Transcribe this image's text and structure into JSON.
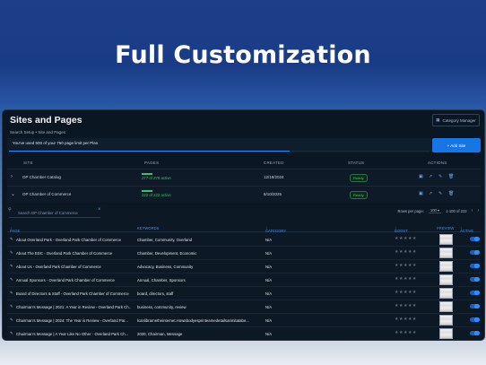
{
  "hero": {
    "title": "Full Customization"
  },
  "app": {
    "title": "Sites and Pages",
    "breadcrumb": "Search Setup • Site and Pages",
    "category_manager": "Category Manager",
    "usage_text": "You've used 500 of your 750 page limit per Plan.",
    "usage_fraction": 0.667,
    "add_site": "+ Add Site",
    "sites_headers": {
      "site": "SITE",
      "pages": "PAGES",
      "created": "CREATED",
      "status": "STATUS",
      "actions": "ACTIONS"
    },
    "sites": [
      {
        "name": "OP Chamber Catalog",
        "pages": "277 of 278 active",
        "pages_fraction": 0.996,
        "created": "12/18/2024",
        "status": "Ready"
      },
      {
        "name": "OP Chamber of Commerce",
        "pages": "222 of 222 active",
        "pages_fraction": 1.0,
        "created": "8/10/2025",
        "status": "Ready"
      }
    ],
    "search_placeholder": "Search OP Chamber of Commerce",
    "pager": {
      "rows_label": "Rows per page:",
      "rows_value": "100",
      "range": "1-100 of 222"
    },
    "page_headers": {
      "page": "PAGE",
      "keywords": "KEYWORDS",
      "category": "CATEGORY",
      "boost": "BOOST",
      "preview": "PREVIEW",
      "active": "ACTIVE"
    },
    "pages": [
      {
        "title": "About Overland Park - Overland Park Chamber of Commerce",
        "keywords": "Chamber, Community, Overland",
        "category": "N/A"
      },
      {
        "title": "About The EDC - Overland Park Chamber of Commerce",
        "keywords": "Chamber, Development, Economic",
        "category": "N/A"
      },
      {
        "title": "About Us - Overland Park Chamber of Commerce",
        "keywords": "Advocacy, Business, Community",
        "category": "N/A"
      },
      {
        "title": "Annual Sponsors - Overland Park Chamber of Commerce",
        "keywords": "Annual, Chamber, Sponsors",
        "category": "N/A"
      },
      {
        "title": "Board of Directors & Staff - Overland Park Chamber of Commerce",
        "keywords": "board, directors, staff",
        "category": "N/A"
      },
      {
        "title": "Chairman's Message | 2021: A Year in Review - Overland Park Ch...",
        "keywords": "business, community, review",
        "category": "N/A"
      },
      {
        "title": "Chairman's Message | 2024: The Year is Review - Overland Par...",
        "keywords": "lcanlibrarnetheinternet.Howabodyesprinteamedetailsarimitatabe...",
        "category": "N/A"
      },
      {
        "title": "Chairman's Message | A Year Like No Other - Overland Park Ch...",
        "keywords": "2020, Chairman, Message",
        "category": "N/A"
      }
    ]
  },
  "colors": {
    "accent": "#1676e8",
    "success": "#3ac26e",
    "panel": "#0b1623"
  }
}
